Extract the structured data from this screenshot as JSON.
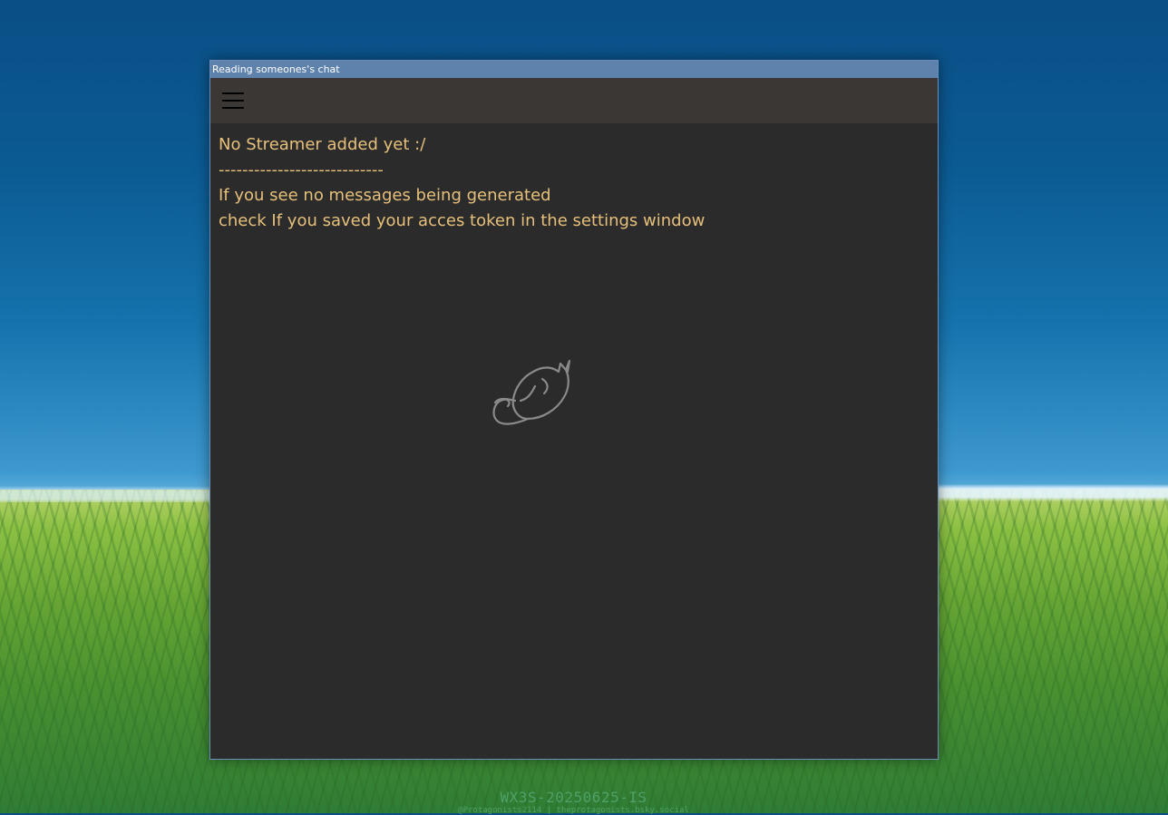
{
  "window": {
    "title": "Reading someones's chat"
  },
  "toolbar": {
    "menu_icon": "hamburger-menu-icon"
  },
  "content": {
    "lines": [
      "No Streamer added yet :/",
      "----------------------------",
      "If you see no messages being generated",
      "check If you saved your acces token in the settings window"
    ],
    "text_color": "#e6c07b",
    "illustration": "sleeping-cat-icon"
  },
  "desktop": {
    "build_label": "WX3S-20250625-IS",
    "credit": "@Protagonists2114 | theprotagonists.bsky.social"
  },
  "colors": {
    "titlebar": "#5f82ad",
    "toolbar": "#3b3735",
    "window_bg": "#2b2b2b"
  }
}
